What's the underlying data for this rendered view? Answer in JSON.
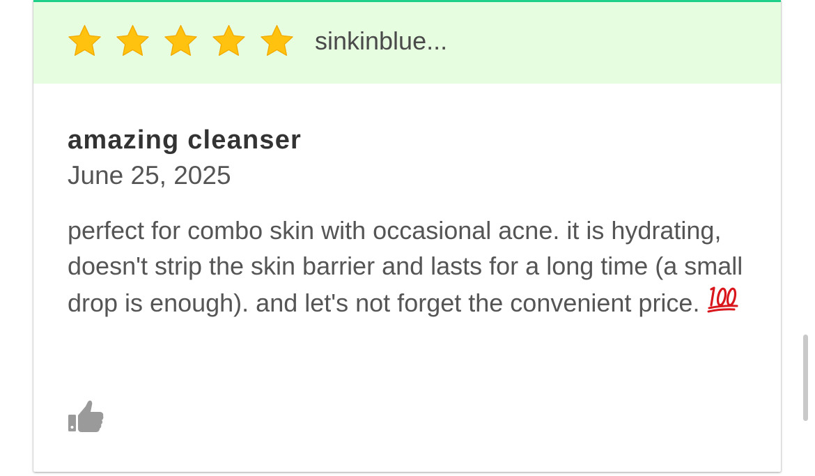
{
  "review": {
    "rating": 5,
    "rating_max": 5,
    "username": "sinkinblue...",
    "title": "amazing cleanser",
    "date": "June 25, 2025",
    "text": "perfect for combo skin with occasional acne. it is hydrating, doesn't strip the skin barrier and lasts for a long time (a small drop is enough). and let's not forget the convenient price.",
    "emoji": "💯"
  },
  "icons": {
    "star": "star-icon",
    "hundred": "hundred-points-emoji",
    "thumbs_up": "thumbs-up-icon"
  },
  "colors": {
    "accent_bar": "#1fd08a",
    "header_bg": "#e6fde0",
    "star": "#ffc20e",
    "star_stroke": "#f2a900",
    "username": "#4a4a4a",
    "title": "#333333",
    "body_text": "#555555",
    "thumb": "#9a9a9a",
    "emoji_red": "#d9161c"
  }
}
